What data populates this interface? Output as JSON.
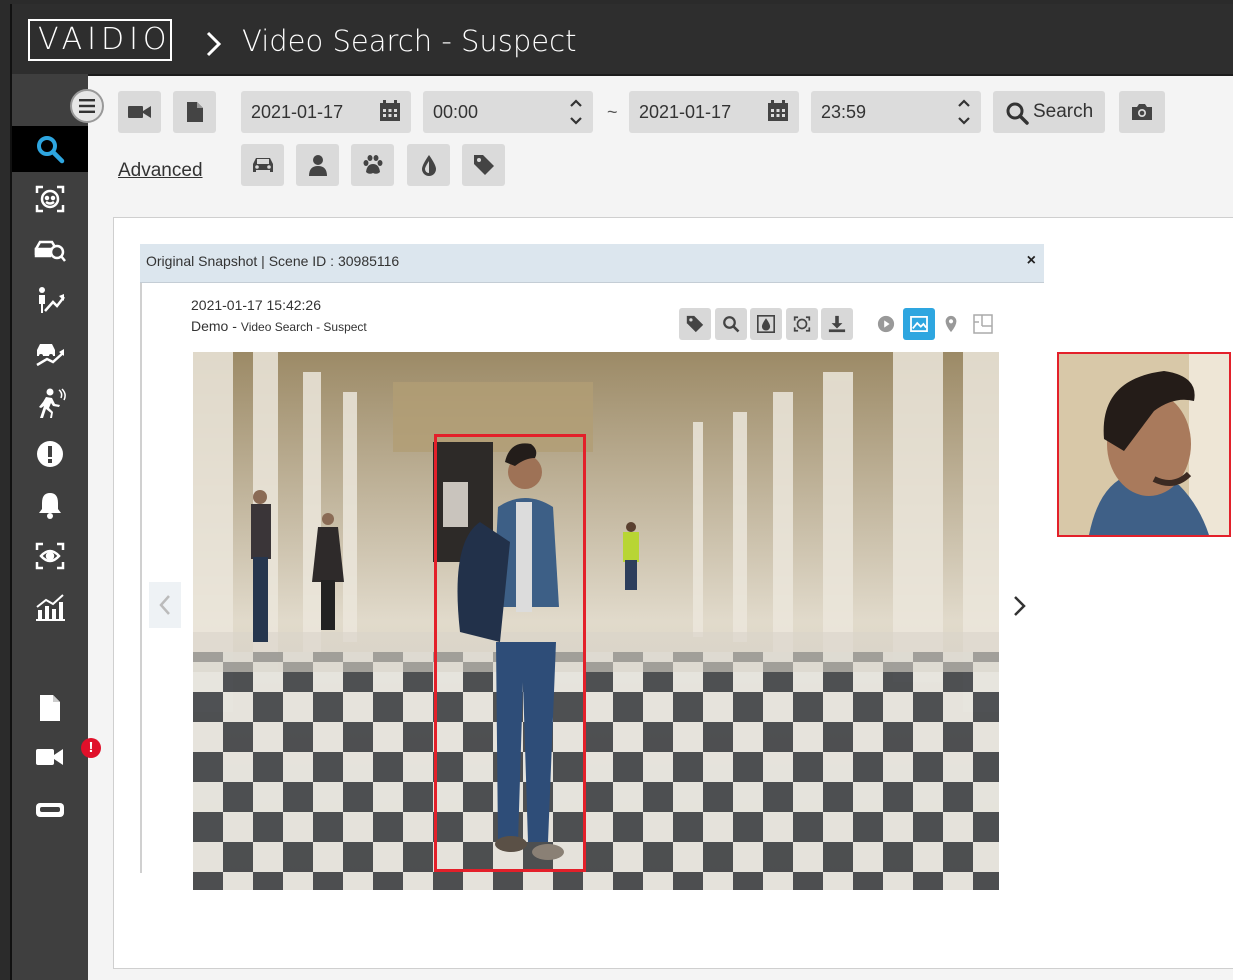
{
  "header": {
    "logo": "VAIDIO",
    "title": "Video Search - Suspect"
  },
  "sidebar": {
    "items": [
      {
        "icon": "search-icon"
      },
      {
        "icon": "face-scan-icon"
      },
      {
        "icon": "car-search-icon"
      },
      {
        "icon": "person-trend-icon"
      },
      {
        "icon": "vehicle-trend-icon"
      },
      {
        "icon": "running-person-icon"
      },
      {
        "icon": "alert-icon"
      },
      {
        "icon": "bell-icon"
      },
      {
        "icon": "eye-scan-icon"
      },
      {
        "icon": "bar-chart-icon"
      },
      {
        "icon": "document-icon"
      },
      {
        "icon": "camera-icon",
        "badge": "!"
      },
      {
        "icon": "storage-icon"
      }
    ]
  },
  "search": {
    "start_date": "2021-01-17",
    "start_time": "00:00",
    "separator": "~",
    "end_date": "2021-01-17",
    "end_time": "23:59",
    "search_label": "Search",
    "advanced_label": "Advanced"
  },
  "filters": [
    "car-icon",
    "person-icon",
    "paw-icon",
    "drop-icon",
    "tag-icon"
  ],
  "snapshot": {
    "header": "Original Snapshot | Scene ID : 30985116",
    "close": "×",
    "timestamp": "2021-01-17 15:42:26",
    "source": "Demo -",
    "source_name": "Video Search - Suspect"
  },
  "colors": {
    "accent": "#2ea6e0",
    "bbox": "#e3202a",
    "badge": "#e0102a"
  }
}
